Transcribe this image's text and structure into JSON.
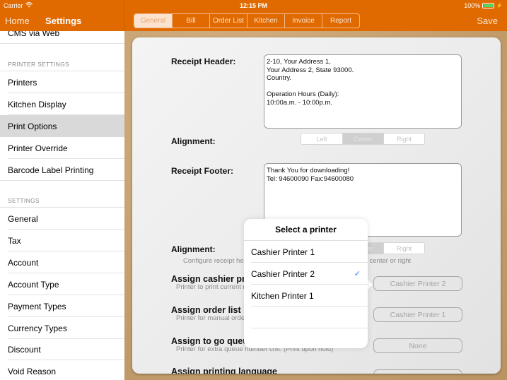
{
  "status_bar": {
    "carrier": "Carrier",
    "time": "12:15 PM",
    "battery": "100%",
    "battery_level_percent": 100
  },
  "nav": {
    "back_label": "Home",
    "title": "Settings",
    "save_label": "Save"
  },
  "tabs": [
    {
      "label": "General",
      "active": true
    },
    {
      "label": "Bill",
      "active": false
    },
    {
      "label": "Order List",
      "active": false
    },
    {
      "label": "Kitchen",
      "active": false
    },
    {
      "label": "Invoice",
      "active": false
    },
    {
      "label": "Report",
      "active": false
    }
  ],
  "sidebar": {
    "top_item": "CMS via Web",
    "sections": [
      {
        "header": "PRINTER SETTINGS",
        "items": [
          {
            "label": "Printers",
            "selected": false
          },
          {
            "label": "Kitchen Display",
            "selected": false
          },
          {
            "label": "Print Options",
            "selected": true
          },
          {
            "label": "Printer Override",
            "selected": false
          },
          {
            "label": "Barcode Label Printing",
            "selected": false
          }
        ]
      },
      {
        "header": "SETTINGS",
        "items": [
          {
            "label": "General"
          },
          {
            "label": "Tax"
          },
          {
            "label": "Account"
          },
          {
            "label": "Account Type"
          },
          {
            "label": "Payment Types"
          },
          {
            "label": "Currency Types"
          },
          {
            "label": "Discount"
          },
          {
            "label": "Void Reason"
          }
        ]
      }
    ]
  },
  "form": {
    "receipt_header_label": "Receipt Header:",
    "receipt_header_value": "2-10, Your Address 1,\nYour Address 2, State 93000.\nCountry.\n\nOperation Hours (Daily):\n10:00a.m. - 10:00p.m.",
    "alignment_label": "Alignment:",
    "alignment_options": [
      "Left",
      "Center",
      "Right"
    ],
    "header_alignment_selected": "Center",
    "receipt_footer_label": "Receipt Footer:",
    "receipt_footer_value": "Thank You for downloading!\nTel: 94600090 Fax:94600080",
    "footer_alignment_label": "Alignment:",
    "alignment_hint": "Configure receipt header and footer alignment adjusted to left, center or right",
    "assign_cashier_label": "Assign cashier printer",
    "assign_cashier_sub": "Printer to print current receipt",
    "assign_cashier_value": "Cashier Printer 2",
    "assign_order_list_label": "Assign order list printer",
    "assign_order_list_sub": "Printer for manual order list",
    "assign_order_list_value": "Cashier Printer 1",
    "assign_to_go_label": "Assign to go queue printer",
    "assign_to_go_sub": "Printer for extra queue number chit. (Print upon hold)",
    "assign_to_go_value": "None",
    "assign_language_label": "Assign printing language"
  },
  "popover": {
    "title": "Select a printer",
    "options": [
      {
        "label": "Cashier Printer 1",
        "selected": false
      },
      {
        "label": "Cashier Printer 2",
        "selected": true
      },
      {
        "label": "Kitchen Printer 1",
        "selected": false
      },
      {
        "label": "",
        "selected": false
      },
      {
        "label": "",
        "selected": false
      }
    ],
    "check_icon": "✓"
  },
  "colors": {
    "brand_orange": "#e06a00",
    "check_blue": "#1a7cf5",
    "selected_row": "#d9d9d9"
  }
}
